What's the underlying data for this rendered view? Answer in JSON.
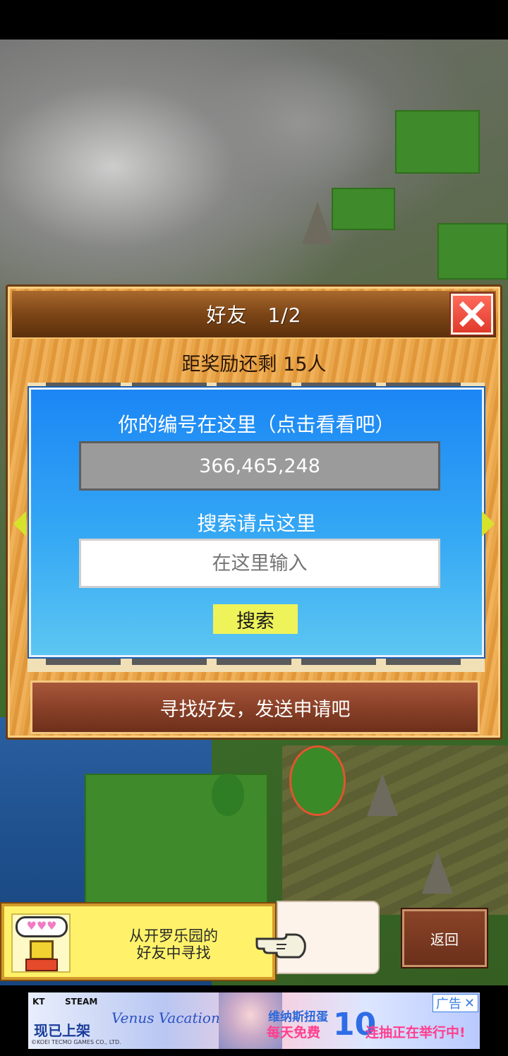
{
  "dialog": {
    "title": "好友　1/2",
    "reward_text": "距奖励还剩 15人"
  },
  "panel": {
    "id_label": "你的编号在这里（点击看看吧）",
    "player_id": "366,465,248",
    "search_label": "搜索请点这里",
    "search_placeholder": "在这里输入",
    "search_button": "搜索"
  },
  "find_friends_button": "寻找好友，发送申请吧",
  "hint": {
    "bubble": "♥♥♥",
    "text_line1": "从开罗乐园的",
    "text_line2": "好友中寻找"
  },
  "back_button": "返回",
  "ad": {
    "brand_kt": "KT",
    "brand_steam": "STEAM",
    "release": "现已上架",
    "game_logo": "Venus Vacation",
    "copyright": "©KOEI TECMO GAMES CO., LTD.",
    "line1": "维纳斯扭蛋",
    "line2": "每天免费",
    "number": "10",
    "line3": "连抽正在举行中!",
    "badge": "广告",
    "badge_close": "✕"
  },
  "colors": {
    "dialog_wood": "#e9a64a",
    "panel_blue": "#1b86f5",
    "close_red": "#e03a2c",
    "search_button": "#eef35a",
    "find_button": "#8a4128"
  }
}
